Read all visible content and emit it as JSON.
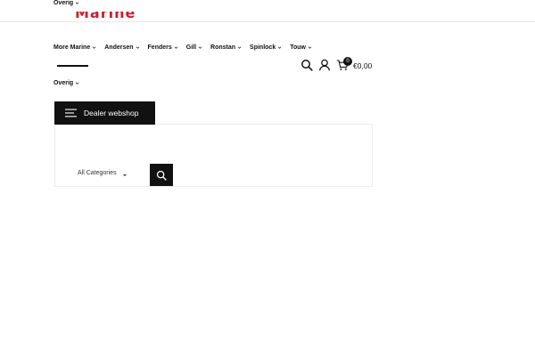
{
  "topbar": {
    "overig_label": "Overig"
  },
  "logo": {
    "text": "Marine"
  },
  "nav": {
    "items": [
      {
        "label": "More Marine"
      },
      {
        "label": "Andersen"
      },
      {
        "label": "Fenders"
      },
      {
        "label": "Gill"
      },
      {
        "label": "Ronstan"
      },
      {
        "label": "Spinlock"
      },
      {
        "label": "Touw"
      }
    ],
    "second_row_label": "Overig"
  },
  "header_actions": {
    "search_icon": "search-icon",
    "account_icon": "user-icon",
    "cart_icon": "cart-icon",
    "cart_count": "0",
    "cart_total": "€0,00"
  },
  "dealer_menu": {
    "label": "Dealer webshop"
  },
  "search": {
    "category_selected": "All Categories",
    "button_icon": "search-icon"
  },
  "colors": {
    "brand_red": "#c8202f",
    "dark": "#111111"
  }
}
